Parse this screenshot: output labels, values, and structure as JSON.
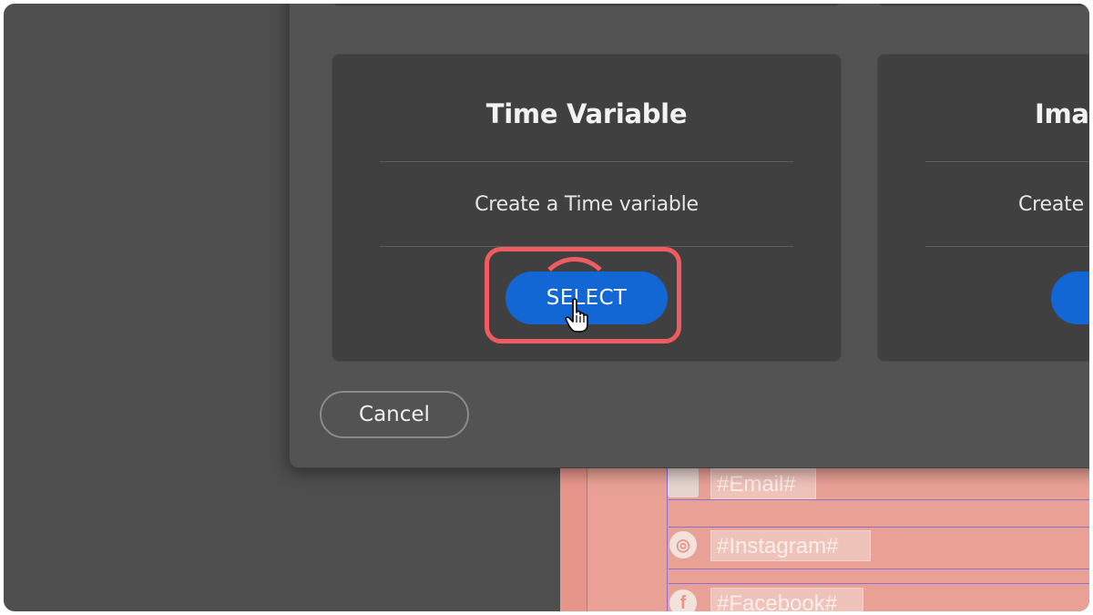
{
  "modal": {
    "cards": [
      {
        "title": "Time Variable",
        "description": "Create a Time variable",
        "button_label": "SELECT"
      },
      {
        "title": "Imag",
        "description": "Create a"
      }
    ],
    "cancel_label": "Cancel"
  },
  "background_document": {
    "fields": [
      {
        "icon": "email-icon",
        "text": "#Email#"
      },
      {
        "icon": "instagram-icon",
        "text": "#Instagram#"
      },
      {
        "icon": "facebook-icon",
        "text": "#Facebook#"
      }
    ]
  },
  "colors": {
    "accent": "#1267d4",
    "highlight": "#ee5b60",
    "modal_bg": "#535353",
    "card_bg": "#404040",
    "document_bg": "#e7958a"
  }
}
